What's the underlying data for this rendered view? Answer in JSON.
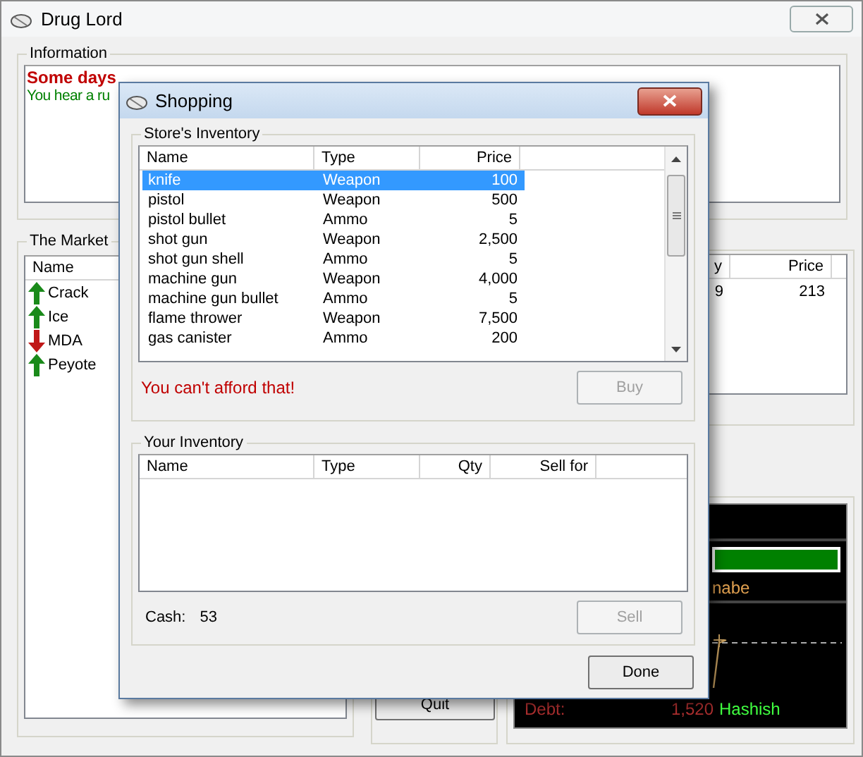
{
  "window": {
    "title": "Drug Lord"
  },
  "information": {
    "title": "Information",
    "messages": [
      {
        "text": "Some days",
        "kind": "alert"
      },
      {
        "text": "You hear a ru",
        "kind": "rumor"
      }
    ]
  },
  "market": {
    "title": "The Market",
    "columns": [
      "Name"
    ],
    "items": [
      {
        "name": "Crack",
        "kind": "up"
      },
      {
        "name": "Ice",
        "kind": "up"
      },
      {
        "name": "MDA",
        "kind": "down"
      },
      {
        "name": "Peyote",
        "kind": "up"
      }
    ]
  },
  "holdings": {
    "columns": [
      "y",
      "Price"
    ],
    "rows": [
      [
        "9",
        "213"
      ]
    ]
  },
  "status_panel": {
    "health": {
      "level": 1
    },
    "rank": "nabe",
    "graph_label": "Hashish",
    "debt_label": "Debt:",
    "debt_value": "1,520"
  },
  "quit_button": "Quit",
  "dialog": {
    "title": "Shopping",
    "store": {
      "title": "Store's Inventory",
      "columns": [
        "Name",
        "Type",
        "Price"
      ],
      "rows": [
        {
          "name": "knife",
          "type": "Weapon",
          "price": "100",
          "selected": true
        },
        {
          "name": "pistol",
          "type": "Weapon",
          "price": "500",
          "selected": false
        },
        {
          "name": "pistol bullet",
          "type": "Ammo",
          "price": "5",
          "selected": false
        },
        {
          "name": "shot gun",
          "type": "Weapon",
          "price": "2,500",
          "selected": false
        },
        {
          "name": "shot gun shell",
          "type": "Ammo",
          "price": "5",
          "selected": false
        },
        {
          "name": "machine gun",
          "type": "Weapon",
          "price": "4,000",
          "selected": false
        },
        {
          "name": "machine gun bullet",
          "type": "Ammo",
          "price": "5",
          "selected": false
        },
        {
          "name": "flame thrower",
          "type": "Weapon",
          "price": "7,500",
          "selected": false
        },
        {
          "name": "gas canister",
          "type": "Ammo",
          "price": "200",
          "selected": false
        }
      ],
      "message": "You can't afford that!",
      "buy_button": {
        "label": "Buy",
        "disabled": true
      }
    },
    "inventory": {
      "title": "Your Inventory",
      "columns": [
        "Name",
        "Type",
        "Qty",
        "Sell for"
      ],
      "cash_label": "Cash:",
      "cash_value": "53",
      "sell_button": {
        "label": "Sell",
        "disabled": true
      }
    },
    "done_button": "Done"
  }
}
